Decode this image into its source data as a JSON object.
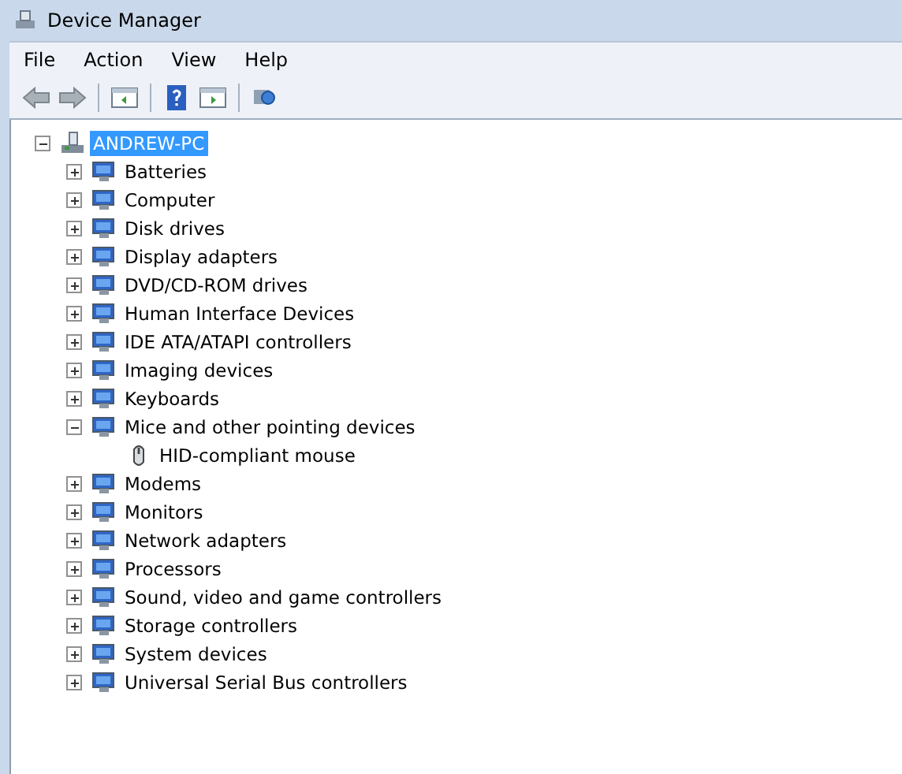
{
  "window": {
    "title": "Device Manager"
  },
  "menu": [
    "File",
    "Action",
    "View",
    "Help"
  ],
  "tree": {
    "label": "ANDREW-PC",
    "selected": true,
    "expanded": true,
    "children": [
      {
        "label": "Batteries",
        "expanded": false,
        "selected": false
      },
      {
        "label": "Computer",
        "expanded": false,
        "selected": false
      },
      {
        "label": "Disk drives",
        "expanded": false,
        "selected": false
      },
      {
        "label": "Display adapters",
        "expanded": false,
        "selected": false
      },
      {
        "label": "DVD/CD-ROM drives",
        "expanded": false,
        "selected": false
      },
      {
        "label": "Human Interface Devices",
        "expanded": false,
        "selected": false
      },
      {
        "label": "IDE ATA/ATAPI controllers",
        "expanded": false,
        "selected": false
      },
      {
        "label": "Imaging devices",
        "expanded": false,
        "selected": false
      },
      {
        "label": "Keyboards",
        "expanded": false,
        "selected": false
      },
      {
        "label": "Mice and other pointing devices",
        "expanded": true,
        "selected": false,
        "children": [
          {
            "label": "HID-compliant mouse",
            "selected": false
          }
        ]
      },
      {
        "label": "Modems",
        "expanded": false,
        "selected": false
      },
      {
        "label": "Monitors",
        "expanded": false,
        "selected": false
      },
      {
        "label": "Network adapters",
        "expanded": false,
        "selected": false
      },
      {
        "label": "Processors",
        "expanded": false,
        "selected": false
      },
      {
        "label": "Sound, video and game controllers",
        "expanded": false,
        "selected": false
      },
      {
        "label": "Storage controllers",
        "expanded": false,
        "selected": false
      },
      {
        "label": "System devices",
        "expanded": false,
        "selected": false
      },
      {
        "label": "Universal Serial Bus controllers",
        "expanded": false,
        "selected": false
      }
    ]
  }
}
